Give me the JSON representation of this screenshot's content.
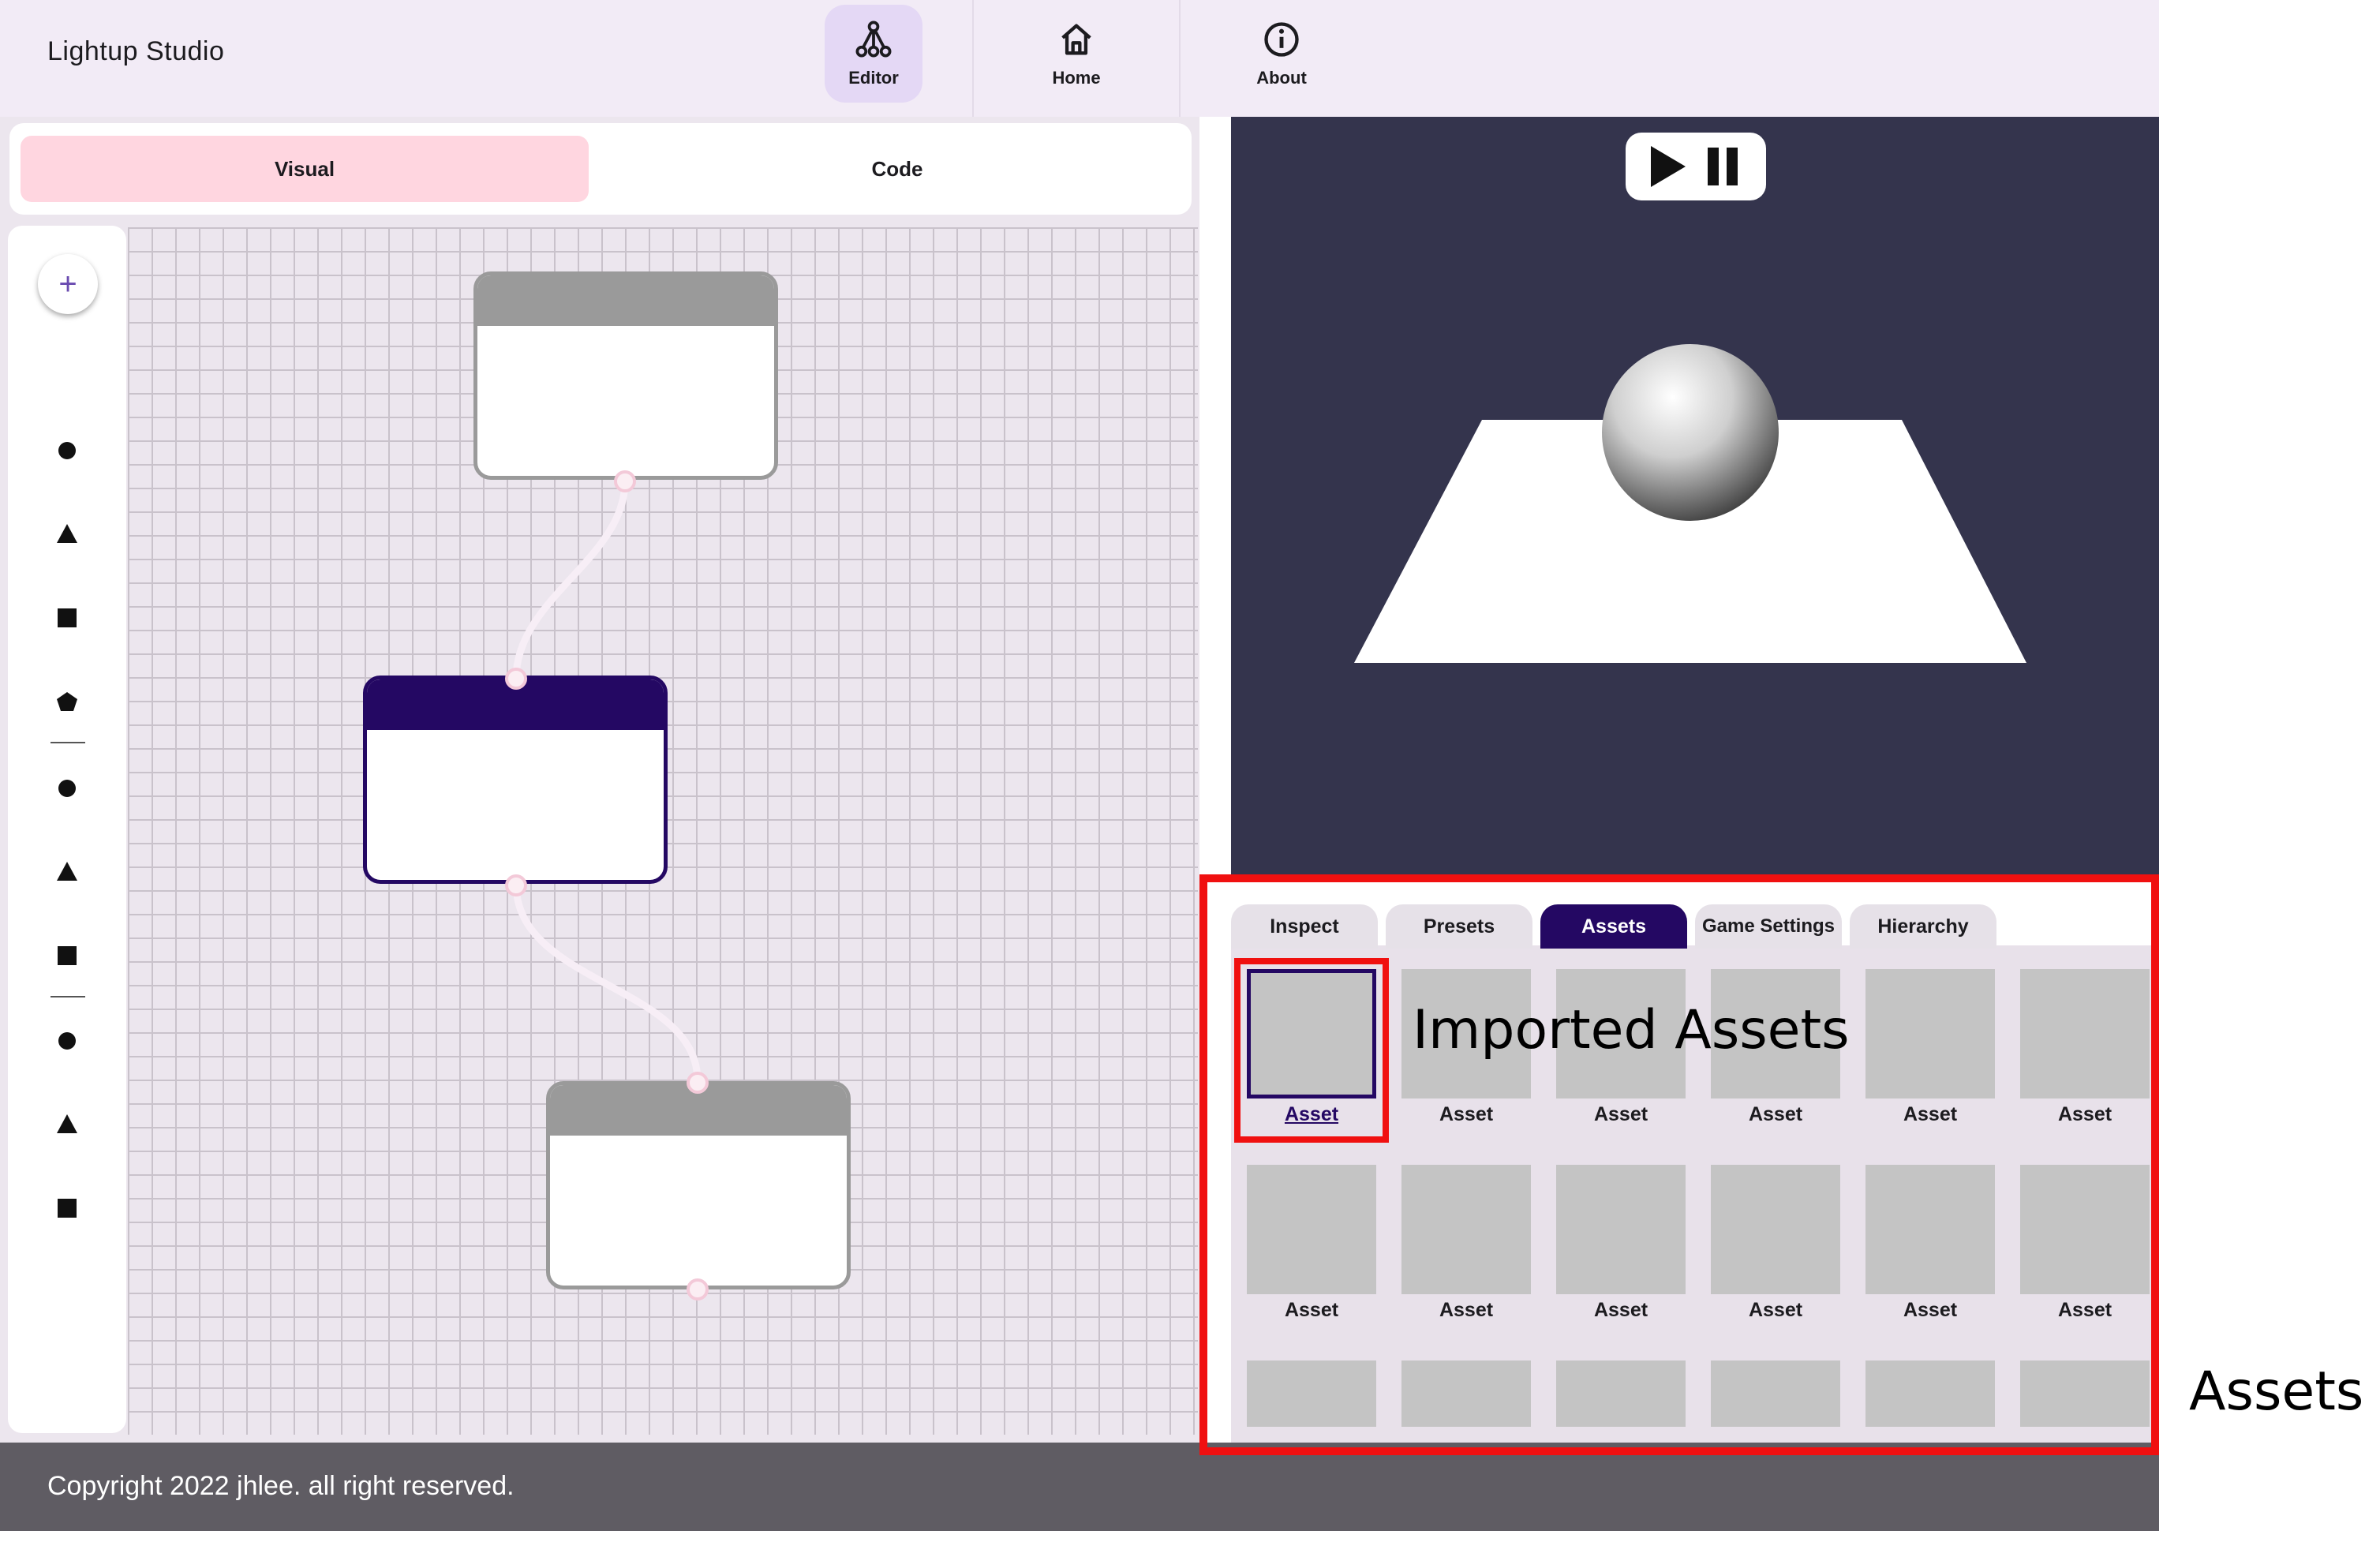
{
  "app": {
    "title": "Lightup Studio"
  },
  "nav": {
    "editor": "Editor",
    "home": "Home",
    "about": "About"
  },
  "editor": {
    "modes": {
      "visual": "Visual",
      "code": "Code"
    },
    "add_label": "+"
  },
  "player": {
    "play_icon": "play-icon",
    "pause_icon": "pause-icon"
  },
  "panel": {
    "tabs": [
      {
        "label": "Inspect",
        "active": false
      },
      {
        "label": "Presets",
        "active": false
      },
      {
        "label": "Assets",
        "active": true
      },
      {
        "label": "Game Settings",
        "active": false
      },
      {
        "label": "Hierarchy",
        "active": false
      }
    ],
    "assets": [
      "Asset",
      "Asset",
      "Asset",
      "Asset",
      "Asset",
      "Asset",
      "Asset",
      "Asset",
      "Asset",
      "Asset",
      "Asset",
      "Asset",
      "",
      "",
      "",
      "",
      "",
      ""
    ]
  },
  "footer": {
    "text": "Copyright 2022 jhlee. all right reserved."
  },
  "annotations": {
    "imported": "Imported Assets",
    "assets": "Assets"
  },
  "colors": {
    "accent_dark": "#240863",
    "accent_pink": "#ffd6e0",
    "annotation": "#f01010",
    "viewport": "#34344d"
  }
}
